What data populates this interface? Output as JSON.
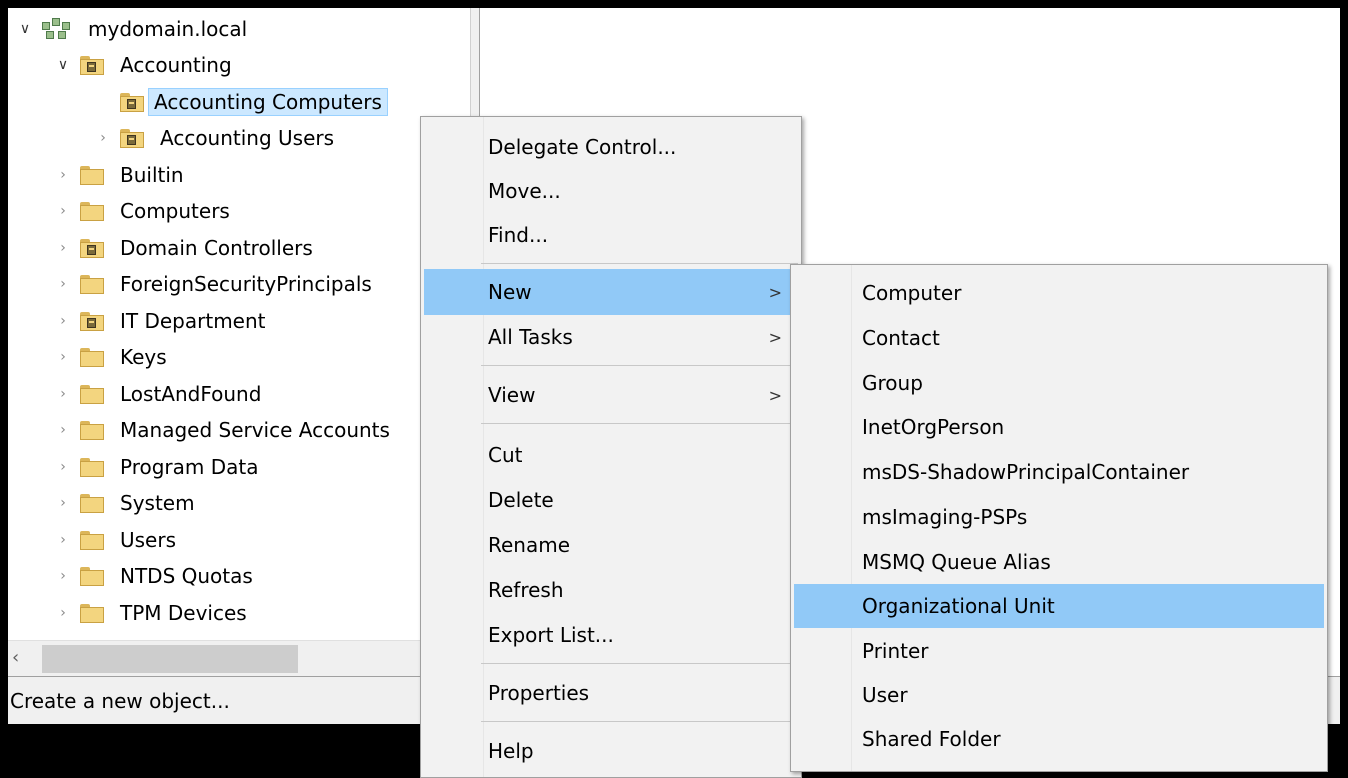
{
  "tree": {
    "root": "mydomain.local",
    "accounting": "Accounting",
    "accounting_computers": "Accounting Computers",
    "accounting_users": "Accounting Users",
    "items": [
      "Builtin",
      "Computers",
      "Domain Controllers",
      "ForeignSecurityPrincipals",
      "IT Department",
      "Keys",
      "LostAndFound",
      "Managed Service Accounts",
      "Program Data",
      "System",
      "Users",
      "NTDS Quotas",
      "TPM Devices"
    ]
  },
  "statusbar": {
    "text": "Create a new object..."
  },
  "context_menu": {
    "delegate": "Delegate Control...",
    "move": "Move...",
    "find": "Find...",
    "new": "New",
    "all_tasks": "All Tasks",
    "view": "View",
    "cut": "Cut",
    "delete": "Delete",
    "rename": "Rename",
    "refresh": "Refresh",
    "export": "Export List...",
    "properties": "Properties",
    "help": "Help",
    "submenu_arrow": ">"
  },
  "new_submenu": {
    "computer": "Computer",
    "contact": "Contact",
    "group": "Group",
    "inetorgperson": "InetOrgPerson",
    "shadow": "msDS-ShadowPrincipalContainer",
    "imaging": "msImaging-PSPs",
    "msmq": "MSMQ Queue Alias",
    "ou": "Organizational Unit",
    "printer": "Printer",
    "user": "User",
    "shared_folder": "Shared Folder"
  },
  "colors": {
    "menu_highlight": "#91c9f7",
    "tree_selection": "#cce8ff"
  }
}
